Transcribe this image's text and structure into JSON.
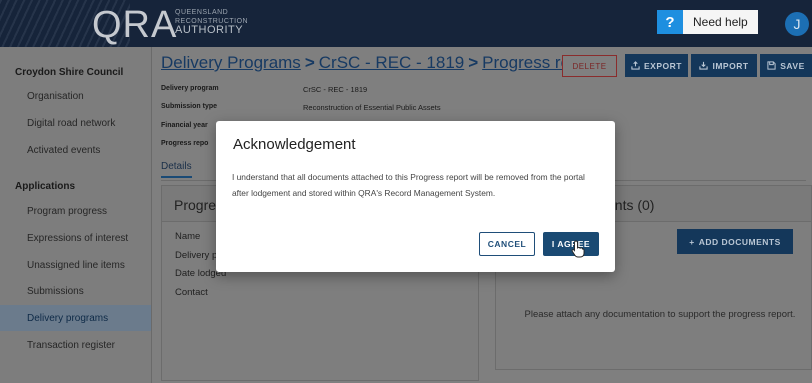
{
  "header": {
    "logo": "QRA",
    "logo_sub_1": "QUEENSLAND",
    "logo_sub_2": "RECONSTRUCTION",
    "logo_sub_3": "AUTHORITY",
    "help_symbol": "?",
    "help_label": "Need help",
    "avatar_initial": "J"
  },
  "sidebar": {
    "council": "Croydon Shire Council",
    "items_top": [
      "Organisation",
      "Digital road network",
      "Activated events"
    ],
    "applications_heading": "Applications",
    "items_apps": [
      "Program progress",
      "Expressions of interest",
      "Unassigned line items",
      "Submissions",
      "Delivery programs",
      "Transaction register"
    ],
    "active_item": "Delivery programs"
  },
  "breadcrumb": {
    "crumb1": "Delivery Programs",
    "crumb2": "CrSC - REC - 1819",
    "crumb3": "Progress rep...",
    "separator": ">"
  },
  "toolbar": {
    "delete_label": "DELETE",
    "export_label": "EXPORT",
    "import_label": "IMPORT",
    "save_label": "SAVE"
  },
  "meta": {
    "delivery_program_label": "Delivery program",
    "delivery_program_value": "CrSC - REC - 1819",
    "submission_type_label": "Submission type",
    "submission_type_value": "Reconstruction of Essential Public Assets",
    "financial_year_label": "Financial year",
    "progress_report_label": "Progress repo"
  },
  "tabs": {
    "details": "Details"
  },
  "progress_card": {
    "title": "Progres",
    "fields": [
      "Name",
      "Delivery p",
      "Date lodged",
      "Contact"
    ]
  },
  "documents_card": {
    "title": "ents (0)",
    "add_label": "ADD DOCUMENTS",
    "hint": "Please attach any documentation to support the progress report."
  },
  "modal": {
    "title": "Acknowledgement",
    "body": "I understand that all documents attached to this Progress report will be removed from the portal after lodgement and stored within QRA's Record Management System.",
    "cancel_label": "CANCEL",
    "agree_label": "I AGREE"
  },
  "colors": {
    "topbar": "#16243a",
    "help_accent": "#1e8fe0",
    "primary_button": "#14375a",
    "delete_border": "#8a2c2c"
  },
  "icons": [
    "export-icon",
    "import-icon",
    "save-icon",
    "plus-icon",
    "pointer-cursor-icon"
  ]
}
